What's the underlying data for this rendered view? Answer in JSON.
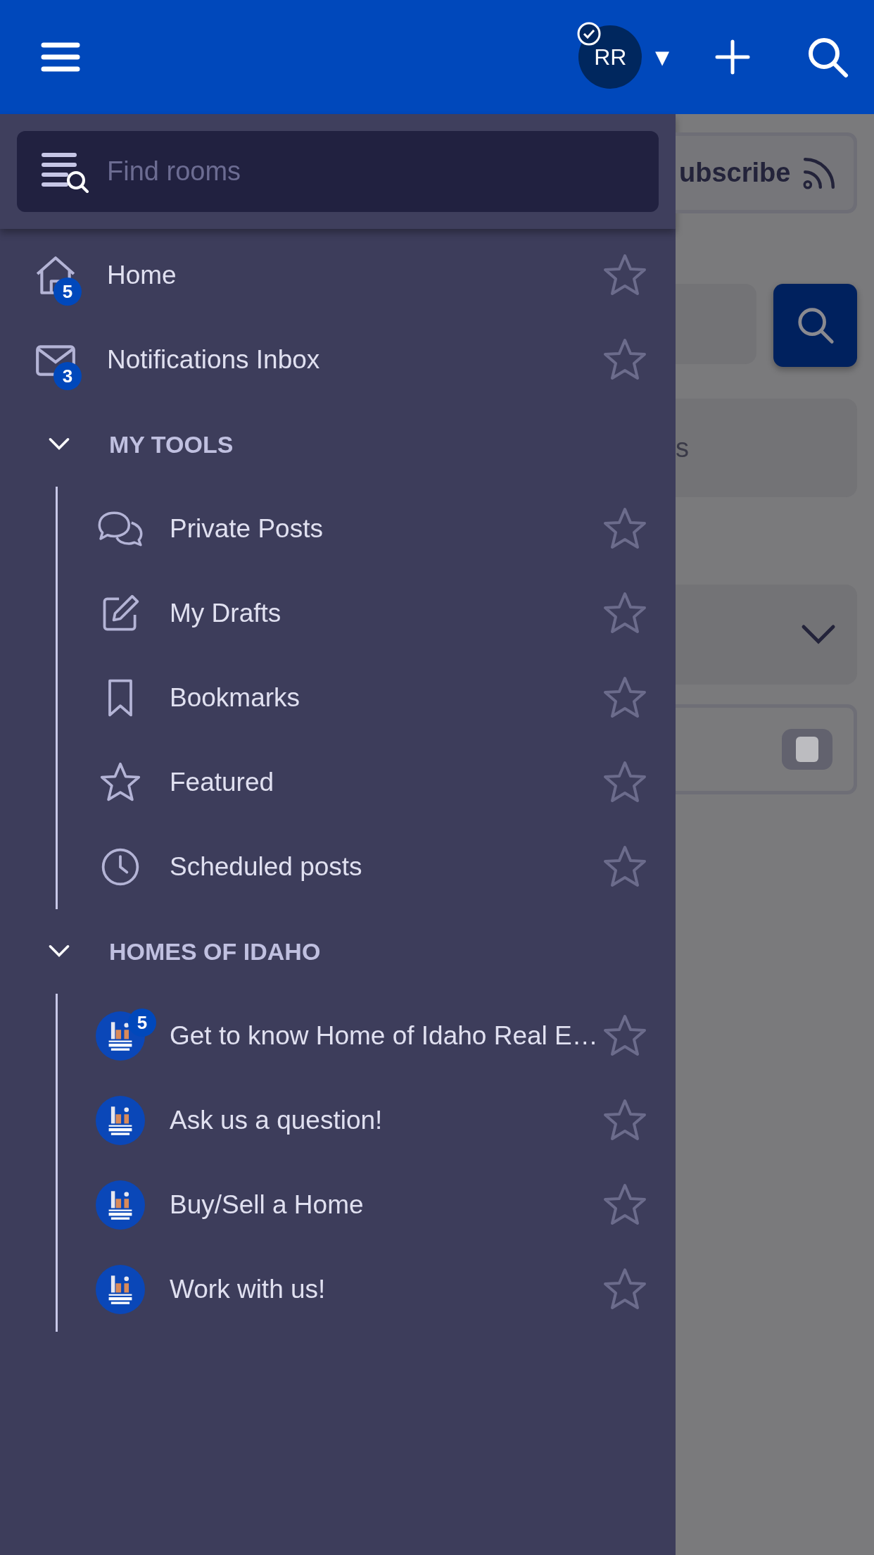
{
  "top_bar": {
    "avatar": {
      "initials": "RR",
      "verified": true
    },
    "dropdown_glyph": "▼"
  },
  "drawer": {
    "search": {
      "placeholder": "Find rooms"
    },
    "items": [
      {
        "kind": "home",
        "label": "Home",
        "badge": "5",
        "starred": false
      },
      {
        "kind": "inbox",
        "label": "Notifications Inbox",
        "badge": "3",
        "starred": false
      }
    ],
    "sections": [
      {
        "title": "MY TOOLS",
        "expanded": true,
        "items": [
          {
            "kind": "chat",
            "label": "Private Posts",
            "starred": false
          },
          {
            "kind": "edit",
            "label": "My Drafts",
            "starred": false
          },
          {
            "kind": "bookmark",
            "label": "Bookmarks",
            "starred": false
          },
          {
            "kind": "star",
            "label": "Featured",
            "starred": false
          },
          {
            "kind": "clock",
            "label": "Scheduled posts",
            "starred": false
          }
        ]
      },
      {
        "title": "HOMES OF IDAHO",
        "expanded": true,
        "items": [
          {
            "kind": "room",
            "label": "Get to know Home of Idaho Real E…",
            "badge": "5",
            "starred": false
          },
          {
            "kind": "room",
            "label": "Ask us a question!",
            "starred": false
          },
          {
            "kind": "room",
            "label": "Buy/Sell a Home",
            "starred": false
          },
          {
            "kind": "room",
            "label": "Work with us!",
            "starred": false
          }
        ]
      }
    ]
  },
  "background_page": {
    "subscribe_label": "ubscribe",
    "card_text": "s",
    "toggle": {
      "on": false
    }
  }
}
